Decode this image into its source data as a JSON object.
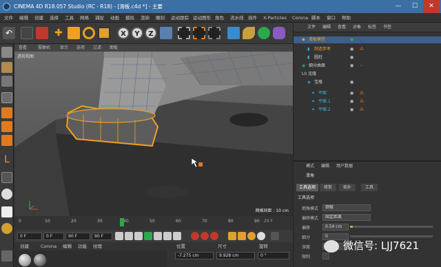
{
  "window": {
    "title": "CINEMA 4D R18.057 Studio (RC - R18) - [滑板.c4d *] - 主要",
    "min": "—",
    "max": "☐",
    "close": "✕"
  },
  "menu": [
    "文件",
    "编辑",
    "创建",
    "选择",
    "工具",
    "网格",
    "捕捉",
    "动画",
    "模拟",
    "渲染",
    "雕刻",
    "运动跟踪",
    "运动图形",
    "角色",
    "流水线",
    "插件",
    "X-Particles",
    "Corona",
    "脚本",
    "窗口",
    "帮助"
  ],
  "toolbar": {
    "x": "X",
    "y": "Y",
    "z": "Z"
  },
  "viewport": {
    "menu": [
      "查看",
      "摄像机",
      "显示",
      "选项",
      "过滤",
      "面板"
    ],
    "label": "透视视图",
    "grid_label": "网格间距 : 10 cm"
  },
  "timeline": {
    "ticks": [
      "0",
      "10",
      "20",
      "30",
      "40",
      "50",
      "60",
      "70",
      "80",
      "90"
    ],
    "frame_display": "29 F",
    "current_frame": 29,
    "max_frame": 90
  },
  "playbar": {
    "start": "0 F",
    "current": "0 F",
    "end": "90 F",
    "end2": "90 F"
  },
  "materials": {
    "menu": [
      "创建",
      "Corona",
      "编辑",
      "功能",
      "纹理"
    ]
  },
  "coords": {
    "headers": [
      "位置",
      "尺寸",
      "旋转"
    ],
    "x_pos": "-7.275 cm",
    "x_size": "9.928 cm",
    "h_rot": "0 °"
  },
  "object_manager": {
    "menu": [
      "文件",
      "编辑",
      "查看",
      "对象",
      "标签",
      "书签"
    ],
    "objects": [
      {
        "name": "滑板模型"
      },
      {
        "name": "制造参考"
      },
      {
        "name": "圆柱"
      },
      {
        "name": "细分曲面"
      },
      {
        "name": "L0 克隆"
      },
      {
        "name": "宝瓶"
      },
      {
        "name": "平面"
      },
      {
        "name": "平面.1"
      },
      {
        "name": "平面.2"
      }
    ]
  },
  "attributes": {
    "menu": [
      "模式",
      "编辑",
      "用户数据"
    ],
    "mode_label": "滑角",
    "tabs": [
      "工具选项",
      "修剪",
      "拓扑",
      "工具"
    ],
    "section": "工具选项",
    "props": [
      {
        "label": "倒角模式",
        "value": "倒棱"
      },
      {
        "label": "偏移模式",
        "value": "固定距离"
      },
      {
        "label": "偏移",
        "value": "0.54 cm"
      },
      {
        "label": "细分",
        "value": "0"
      },
      {
        "label": "深度",
        "value": "100 %"
      },
      {
        "label": "限制",
        "value": ""
      }
    ]
  },
  "watermark": "微信号: LJJ7621",
  "colors": {
    "accent": "#f0a020",
    "title": "#3c6fa3",
    "select": "#3d5f8c"
  }
}
